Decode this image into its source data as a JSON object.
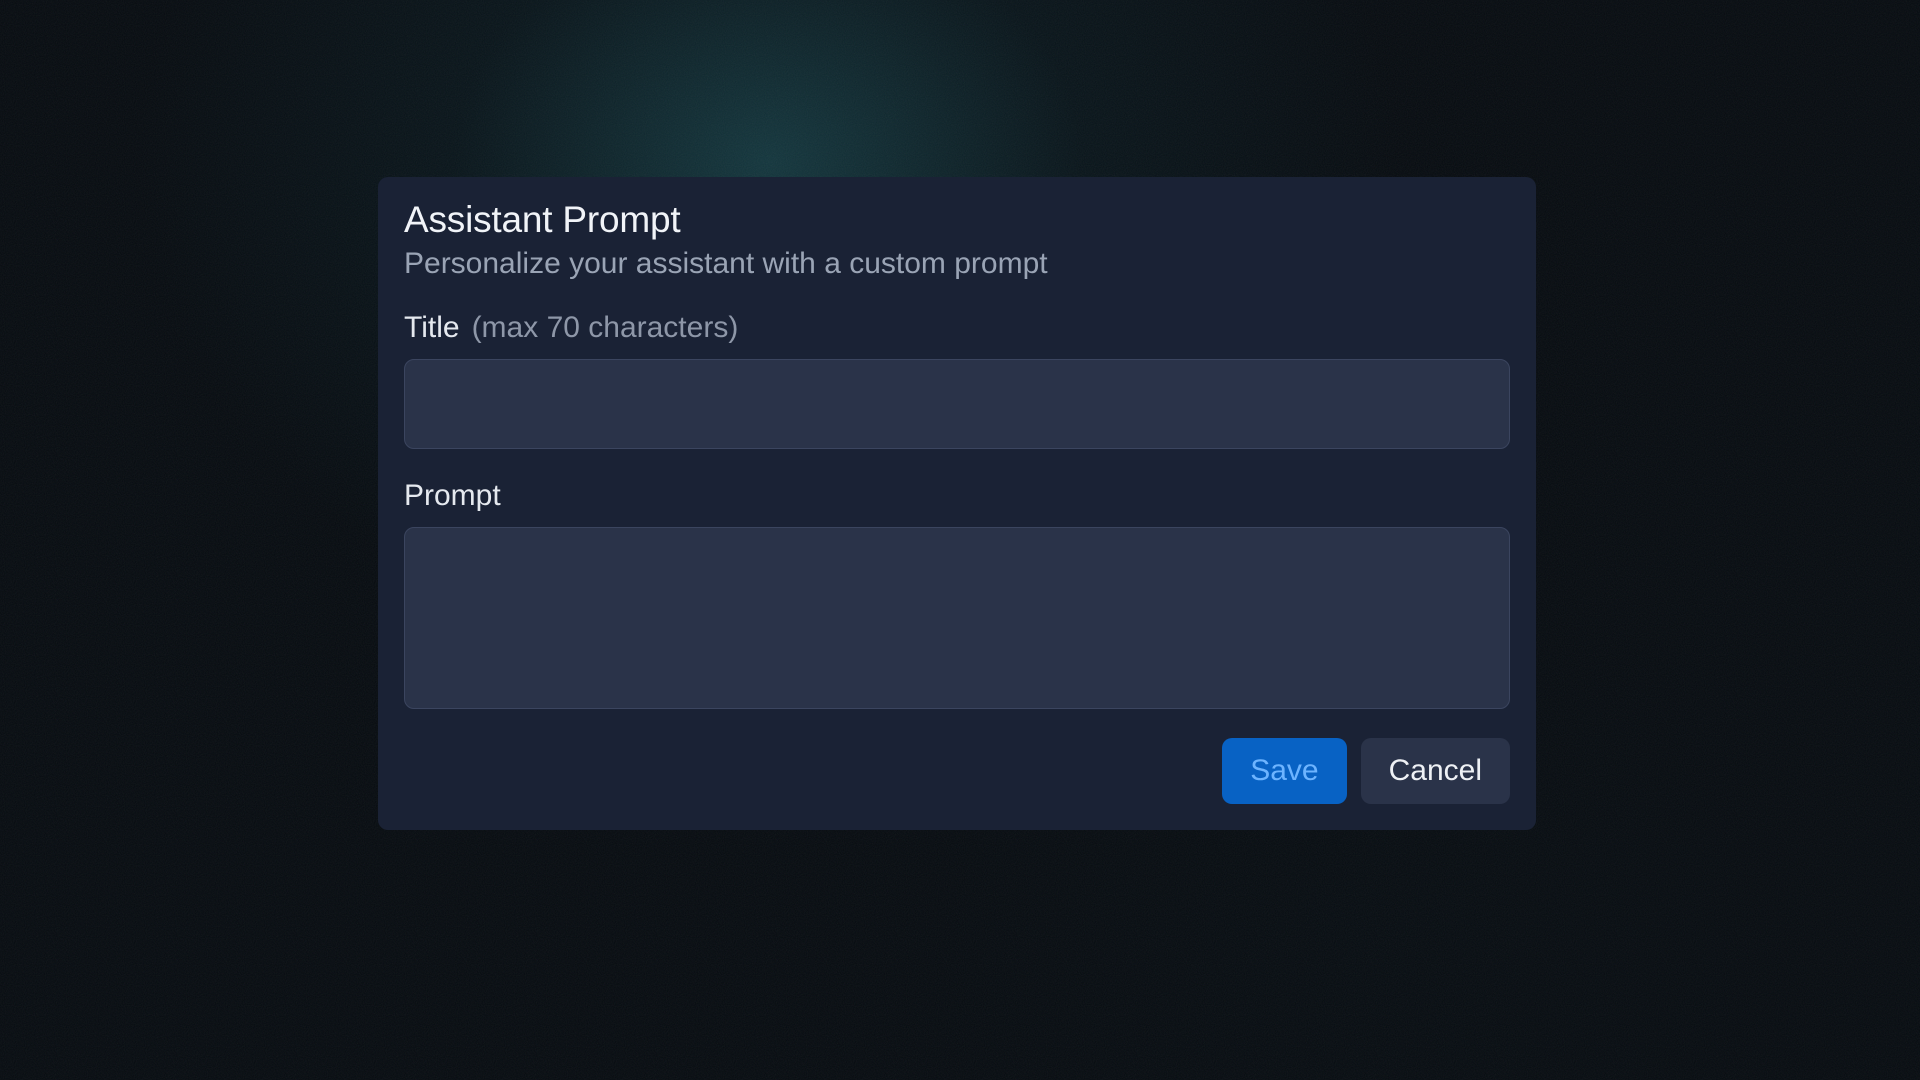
{
  "dialog": {
    "title": "Assistant Prompt",
    "subtitle": "Personalize your assistant with a custom prompt",
    "fields": {
      "title": {
        "label": "Title",
        "hint": "(max 70 characters)",
        "value": ""
      },
      "prompt": {
        "label": "Prompt",
        "value": ""
      }
    },
    "buttons": {
      "save": "Save",
      "cancel": "Cancel"
    }
  }
}
